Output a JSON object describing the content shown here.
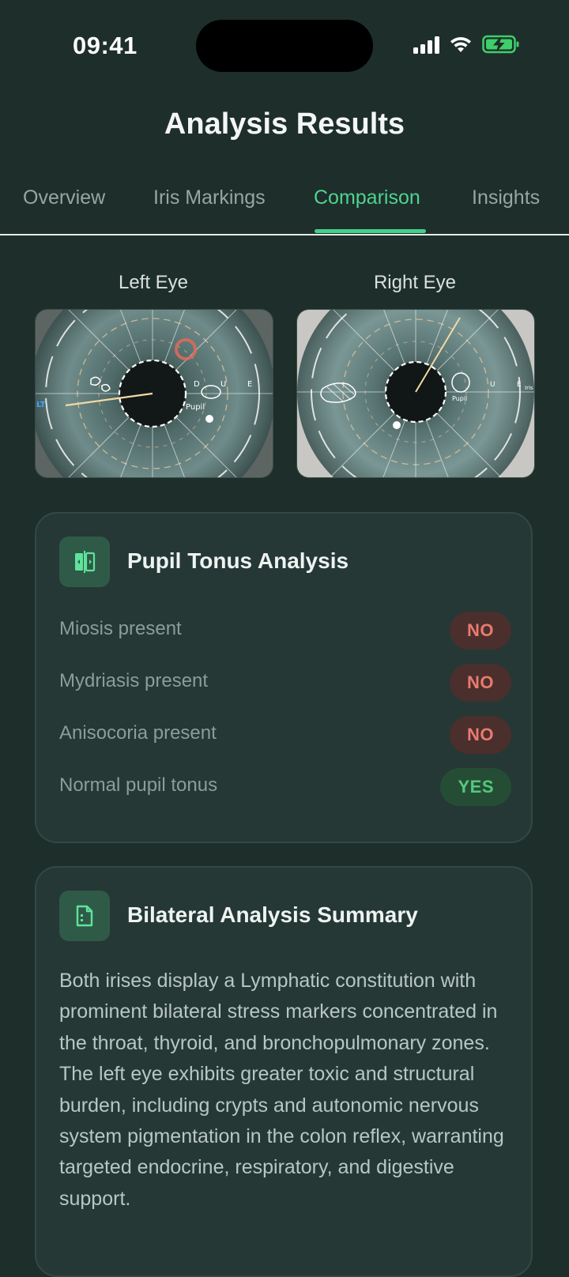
{
  "status_bar": {
    "time": "09:41"
  },
  "header": {
    "title": "Analysis Results"
  },
  "tabs": [
    {
      "label": "Overview",
      "active": false
    },
    {
      "label": "Iris Markings",
      "active": false
    },
    {
      "label": "Comparison",
      "active": true
    },
    {
      "label": "Insights",
      "active": false
    }
  ],
  "eyes": {
    "left": {
      "label": "Left Eye",
      "overlay_labels": [
        "LT",
        "D",
        "U",
        "E",
        "Pupil"
      ]
    },
    "right": {
      "label": "Right Eye",
      "overlay_labels": [
        "U",
        "E",
        "Iris",
        "Pupil"
      ]
    }
  },
  "pupil_tonus": {
    "title": "Pupil Tonus Analysis",
    "icon": "compare-icon",
    "rows": [
      {
        "label": "Miosis present",
        "value": "NO"
      },
      {
        "label": "Mydriasis present",
        "value": "NO"
      },
      {
        "label": "Anisocoria present",
        "value": "NO"
      },
      {
        "label": "Normal pupil tonus",
        "value": "YES"
      }
    ]
  },
  "summary": {
    "title": "Bilateral Analysis Summary",
    "icon": "document-icon",
    "text": "Both irises display a Lymphatic constitution with prominent bilateral stress markers concentrated in the throat, thyroid, and bronchopulmonary zones. The left eye exhibits greater toxic and structural burden, including crypts and autonomic nervous system pigmentation in the colon reflex, warranting targeted endocrine, respiratory, and digestive support."
  },
  "colors": {
    "background": "#1e2e2b",
    "accent": "#44d08a",
    "card": "#253835",
    "no_badge": "#e97a6e",
    "yes_badge": "#54c97c"
  }
}
